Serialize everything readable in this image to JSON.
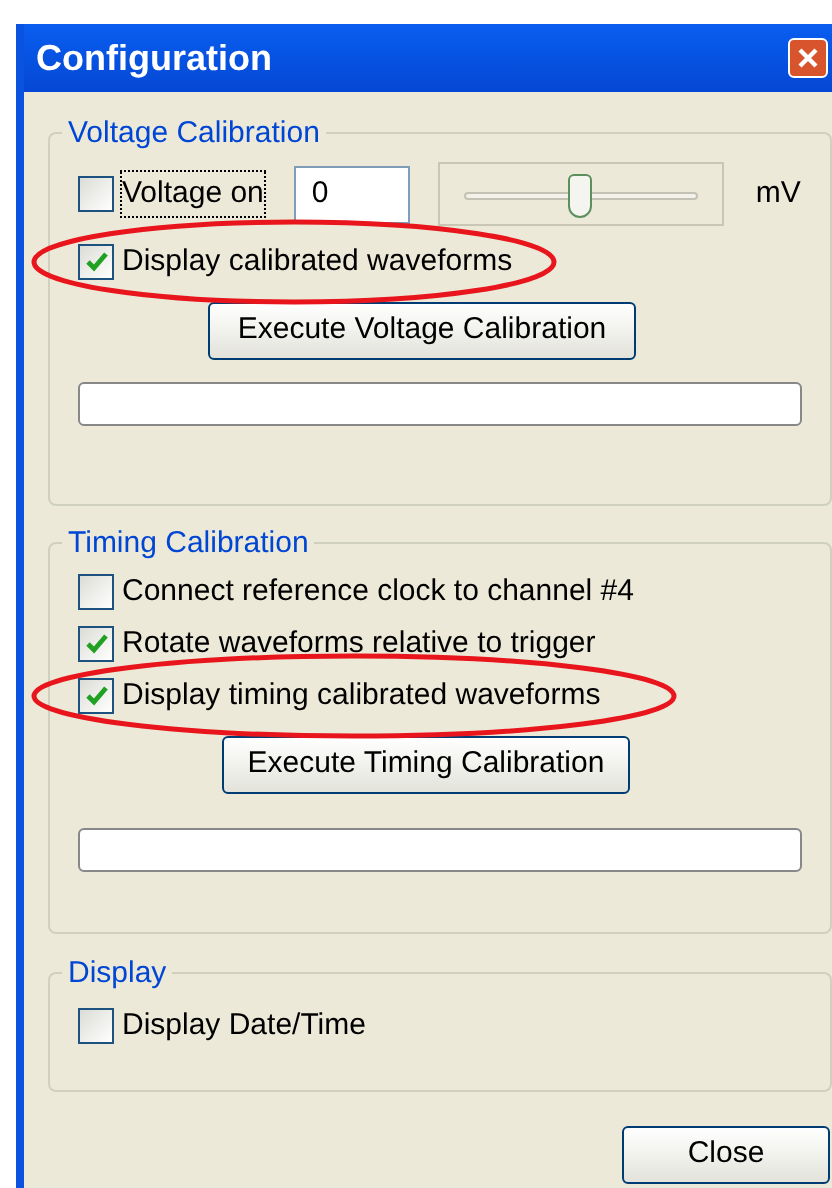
{
  "window": {
    "title": "Configuration"
  },
  "voltage_calibration": {
    "title": "Voltage Calibration",
    "voltage_on": {
      "label": "Voltage on",
      "checked": false,
      "focused": true
    },
    "value_field": {
      "value": "0"
    },
    "slider": {
      "level": 0.5
    },
    "unit": "mV",
    "options": [
      {
        "label": "Display calibrated waveforms",
        "checked": true,
        "highlighted": true
      }
    ],
    "button": "Execute Voltage Calibration"
  },
  "timing_calibration": {
    "title": "Timing Calibration",
    "options": [
      {
        "label": "Connect reference clock to channel #4",
        "checked": false,
        "highlighted": false
      },
      {
        "label": "Rotate waveforms relative to trigger",
        "checked": true,
        "highlighted": false
      },
      {
        "label": "Display timing calibrated waveforms",
        "checked": true,
        "highlighted": true
      }
    ],
    "button": "Execute Timing Calibration"
  },
  "display": {
    "title": "Display",
    "options": [
      {
        "label": "Display Date/Time",
        "checked": false,
        "highlighted": false
      }
    ]
  },
  "buttons": [
    "Close"
  ]
}
